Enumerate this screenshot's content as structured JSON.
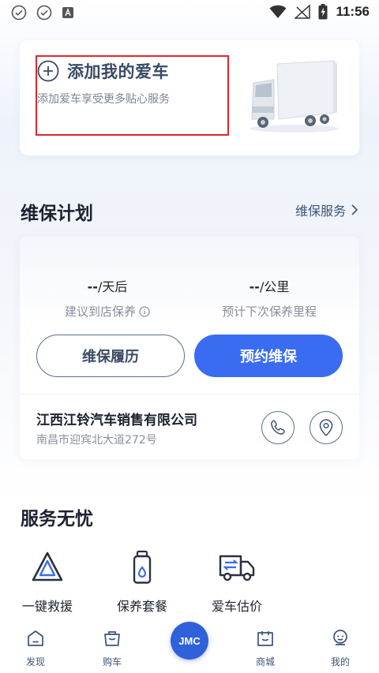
{
  "status_bar": {
    "time": "11:56"
  },
  "car_card": {
    "title": "添加我的爱车",
    "subtitle": "添加爱车享受更多贴心服务"
  },
  "maintenance": {
    "section_title": "维保计划",
    "link_label": "维保服务",
    "stats": [
      {
        "value": "--",
        "unit": "/天后",
        "label": "建议到店保养"
      },
      {
        "value": "--",
        "unit": "/公里",
        "label": "预计下次保养里程"
      }
    ],
    "history_button": "维保履历",
    "book_button": "预约维保",
    "dealer": {
      "name": "江西江铃汽车销售有限公司",
      "address": "南昌市迎宾北大道272号"
    }
  },
  "services": {
    "section_title": "服务无忧",
    "items": [
      {
        "label": "一键救援",
        "icon": "warning-triangle-icon"
      },
      {
        "label": "保养套餐",
        "icon": "oil-bottle-icon"
      },
      {
        "label": "爱车估价",
        "icon": "truck-exchange-icon"
      }
    ]
  },
  "bottom_nav": {
    "items": [
      {
        "label": "发现",
        "icon": "home-icon"
      },
      {
        "label": "购车",
        "icon": "bag-icon"
      },
      {
        "label": "JMC",
        "icon": "jmc-logo"
      },
      {
        "label": "商城",
        "icon": "shop-icon"
      },
      {
        "label": "我的",
        "icon": "user-icon"
      }
    ]
  },
  "colors": {
    "primary": "#3a6cf2",
    "highlight_border": "#e0262b",
    "text_dark": "#1d2230",
    "text_muted": "#878e9b"
  }
}
